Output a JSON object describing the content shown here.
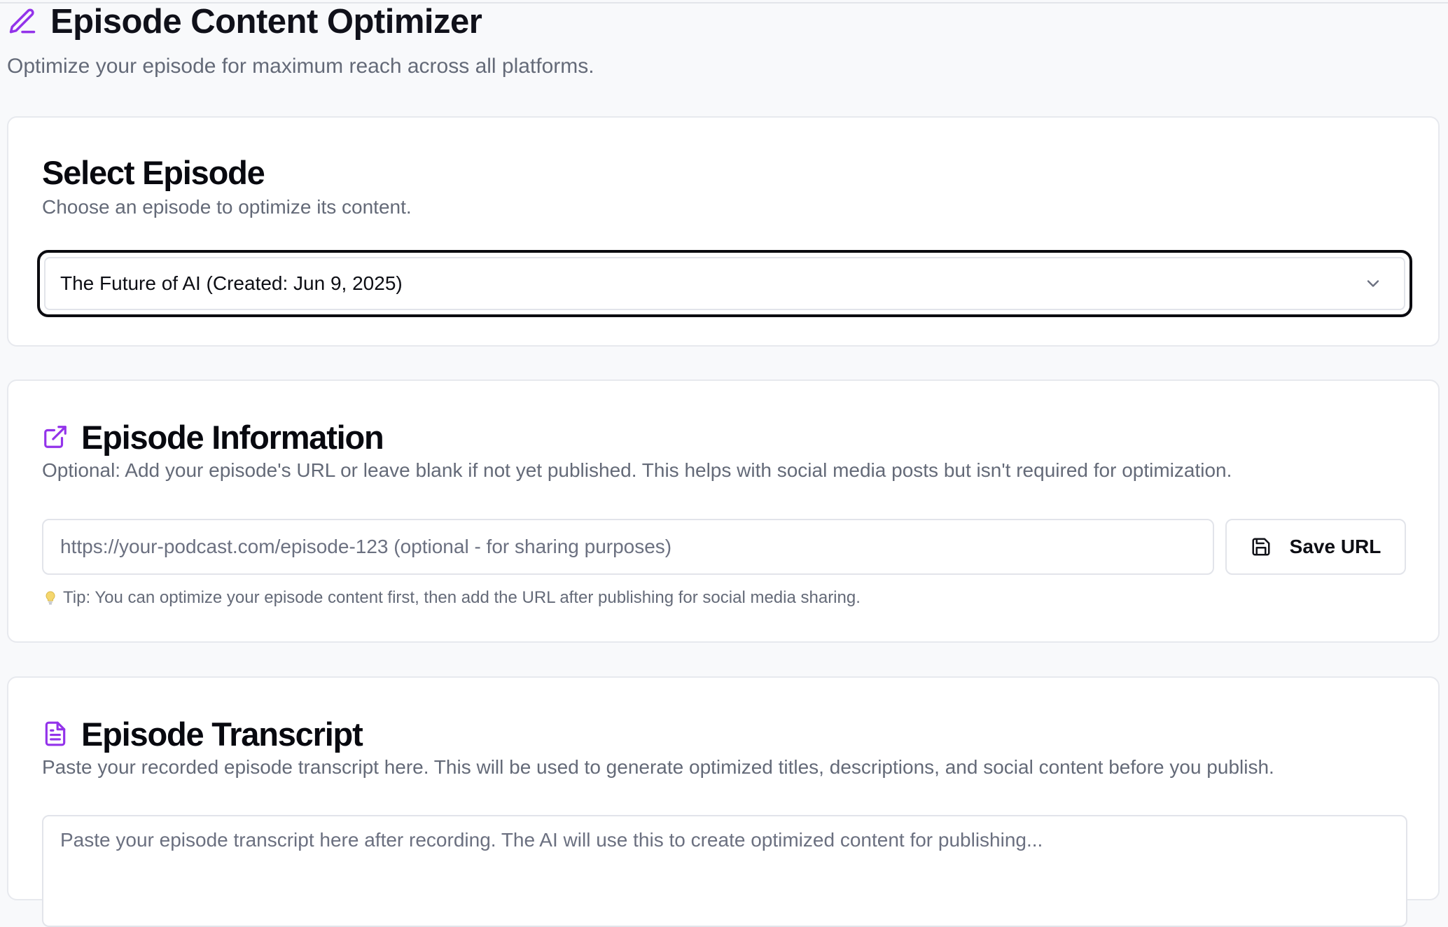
{
  "header": {
    "title": "Episode Content Optimizer",
    "subtitle": "Optimize your episode for maximum reach across all platforms.",
    "icon": "pencil-icon"
  },
  "select_episode": {
    "title": "Select Episode",
    "description": "Choose an episode to optimize its content.",
    "selected_value": "The Future of AI (Created: Jun 9, 2025)",
    "icon": "chevron-down-icon"
  },
  "episode_information": {
    "title": "Episode Information",
    "icon": "external-link-icon",
    "description": "Optional: Add your episode's URL or leave blank if not yet published. This helps with social media posts but isn't required for optimization.",
    "url_value": "",
    "url_placeholder": "https://your-podcast.com/episode-123 (optional - for sharing purposes)",
    "save_label": "Save URL",
    "save_icon": "save-icon",
    "tip_icon": "lightbulb-icon",
    "tip_text": "Tip: You can optimize your episode content first, then add the URL after publishing for social media sharing."
  },
  "episode_transcript": {
    "title": "Episode Transcript",
    "icon": "file-text-icon",
    "description": "Paste your recorded episode transcript here. This will be used to generate optimized titles, descriptions, and social content before you publish.",
    "transcript_value": "",
    "placeholder": "Paste your episode transcript here after recording. The AI will use this to create optimized content for publishing..."
  },
  "colors": {
    "accent": "#9333ea",
    "text_primary": "#0b0b12",
    "text_muted": "#646a78",
    "border": "#e2e4ea",
    "background": "#f8f9fb",
    "tip_bulb": "#f5d76e"
  }
}
